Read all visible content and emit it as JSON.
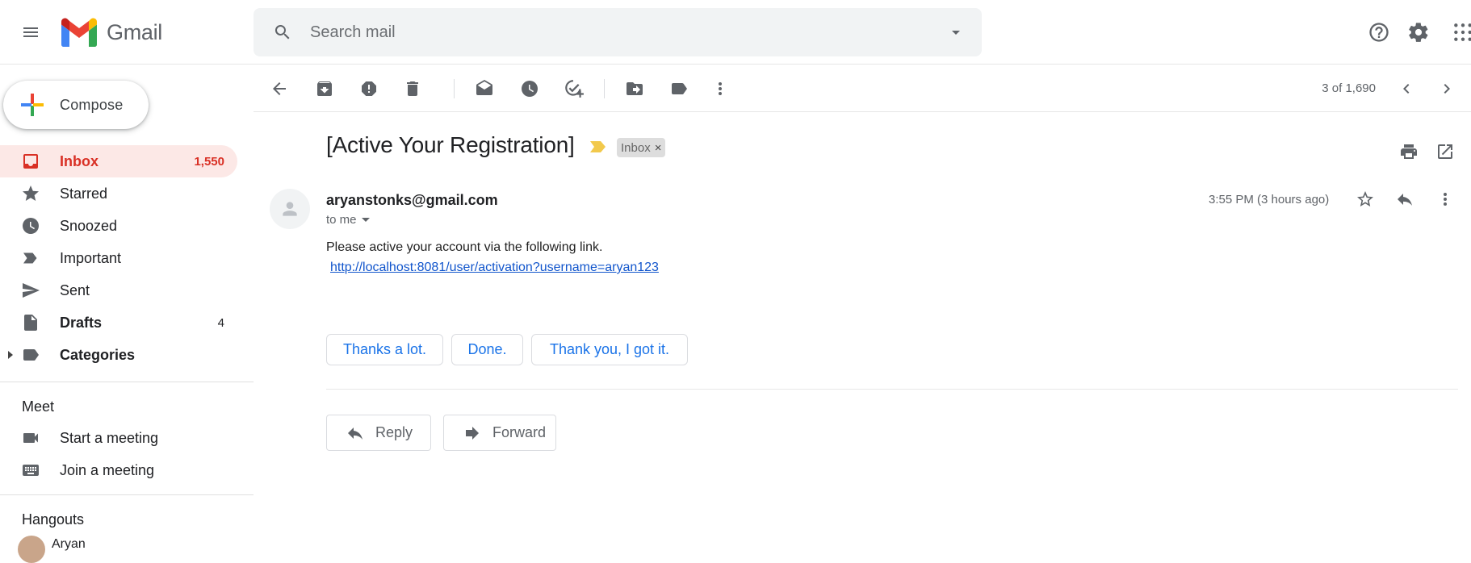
{
  "app": {
    "name": "Gmail"
  },
  "search": {
    "placeholder": "Search mail"
  },
  "compose": {
    "label": "Compose"
  },
  "sidebar": {
    "items": [
      {
        "label": "Inbox",
        "count": "1,550"
      },
      {
        "label": "Starred",
        "count": ""
      },
      {
        "label": "Snoozed",
        "count": ""
      },
      {
        "label": "Important",
        "count": ""
      },
      {
        "label": "Sent",
        "count": ""
      },
      {
        "label": "Drafts",
        "count": "4"
      },
      {
        "label": "Categories",
        "count": ""
      }
    ],
    "meet": {
      "title": "Meet",
      "start": "Start a meeting",
      "join": "Join a meeting"
    },
    "hangouts": {
      "title": "Hangouts",
      "user": "Aryan"
    }
  },
  "toolbar": {
    "pager": "3 of 1,690"
  },
  "message": {
    "subject": "[Active Your Registration]",
    "label": "Inbox",
    "label_remove": "×",
    "sender": "aryanstonks@gmail.com",
    "to": "to me",
    "time": "3:55 PM (3 hours ago)",
    "body": "Please active your account via the following link.",
    "link": "http://localhost:8081/user/activation?username=aryan123",
    "smart_replies": [
      "Thanks a lot.",
      "Done.",
      "Thank you, I got it."
    ],
    "reply_label": "Reply",
    "forward_label": "Forward"
  },
  "colors": {
    "accent_red": "#d93025",
    "active_bg": "#fce8e6",
    "link": "#1155cc",
    "chip_text": "#1a73e8"
  }
}
